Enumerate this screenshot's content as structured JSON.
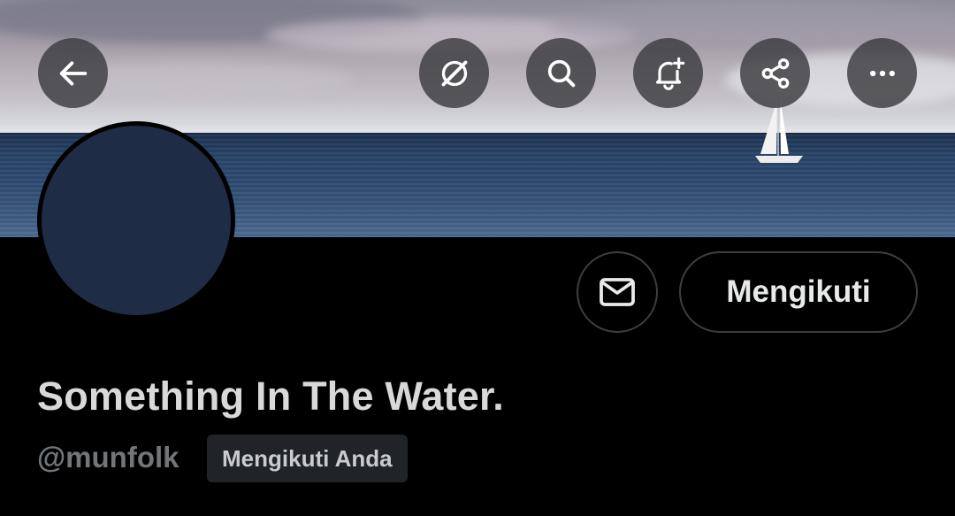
{
  "header": {
    "back_icon": "arrow-left-icon",
    "grok_icon": "grok-slash-icon",
    "search_icon": "search-icon",
    "notify_icon": "bell-plus-icon",
    "share_icon": "share-icon",
    "more_icon": "more-horizontal-icon"
  },
  "profile": {
    "avatar_color": "#1f2c45",
    "display_name": "Something In The Water.",
    "handle": "@munfolk",
    "follows_you_badge": "Mengikuti Anda"
  },
  "actions": {
    "message_icon": "mail-icon",
    "follow_label": "Mengikuti"
  },
  "colors": {
    "background": "#000000",
    "button_border": "#3b3f44",
    "secondary_text": "#71767b"
  }
}
